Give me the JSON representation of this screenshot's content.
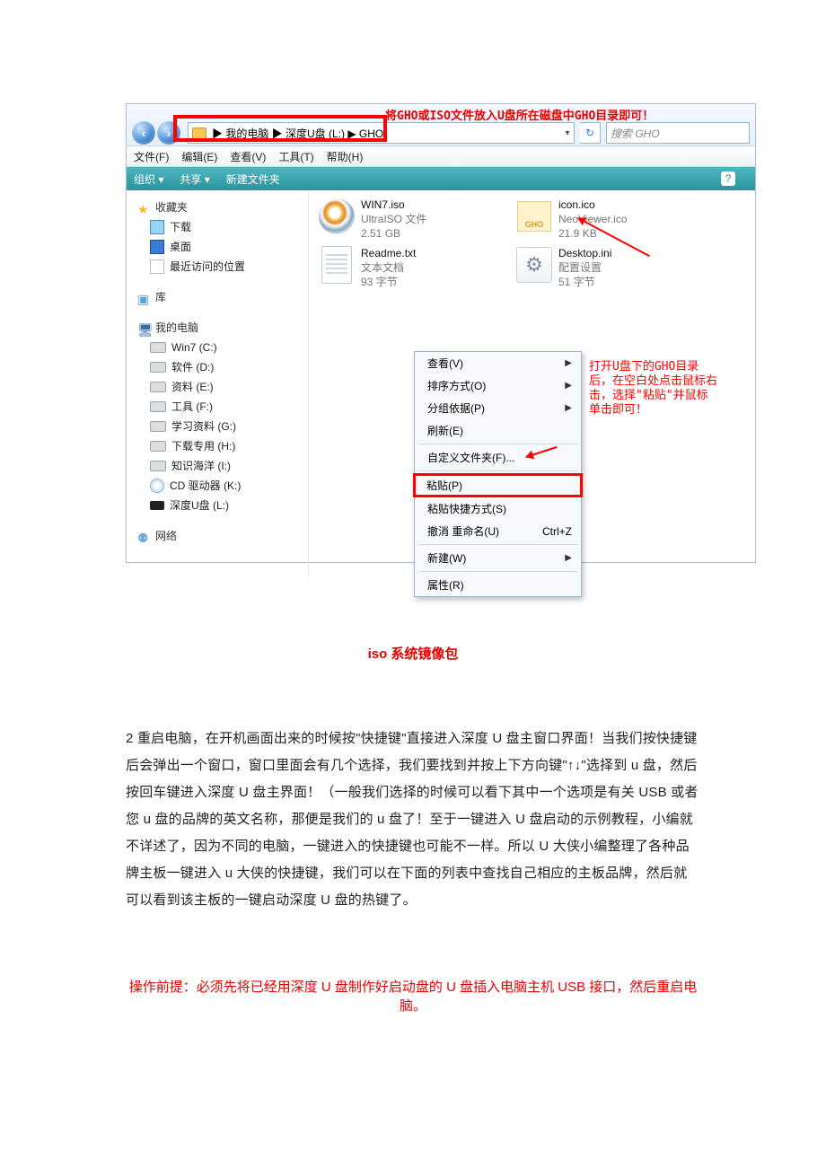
{
  "overlay": {
    "top_note": "将GHO或ISO文件放入U盘所在磁盘中GHO目录即可！"
  },
  "window": {
    "breadcrumb": "▶ 我的电脑 ▶ 深度U盘 (L:) ▶ GHO",
    "search_placeholder": "搜索 GHO",
    "menu": {
      "file": "文件(F)",
      "edit": "编辑(E)",
      "view": "查看(V)",
      "tools": "工具(T)",
      "help": "帮助(H)"
    },
    "cmd": {
      "organize": "组织 ▾",
      "share": "共享 ▾",
      "newfolder": "新建文件夹"
    }
  },
  "nav": {
    "fav": "收藏夹",
    "dl": "下载",
    "desk": "桌面",
    "recent": "最近访问的位置",
    "lib": "库",
    "pc": "我的电脑",
    "drives": [
      "Win7 (C:)",
      "软件 (D:)",
      "资料 (E:)",
      "工具 (F:)",
      "学习资料 (G:)",
      "下载专用 (H:)",
      "知识海洋 (I:)",
      "CD 驱动器 (K:)",
      "深度U盘 (L:)"
    ],
    "net": "网络"
  },
  "files": {
    "iso": {
      "name": "WIN7.iso",
      "sub1": "UltraISO 文件",
      "sub2": "2.51 GB"
    },
    "icon": {
      "name": "icon.ico",
      "sub1": "NeoViewer.ico",
      "sub2": "21.9 KB"
    },
    "readme": {
      "name": "Readme.txt",
      "sub1": "文本文档",
      "sub2": "93 字节"
    },
    "ini": {
      "name": "Desktop.ini",
      "sub1": "配置设置",
      "sub2": "51 字节"
    }
  },
  "ctx": {
    "view": "查看(V)",
    "sort": "排序方式(O)",
    "group": "分组依据(P)",
    "refresh": "刷新(E)",
    "custom": "自定义文件夹(F)...",
    "paste": "粘贴(P)",
    "pshort": "粘贴快捷方式(S)",
    "undo": "撤消 重命名(U)",
    "undo_key": "Ctrl+Z",
    "new": "新建(W)",
    "prop": "属性(R)"
  },
  "note1": {
    "l1": "打开U盘下的GHO目录",
    "l2": "后，在空白处点击鼠标右",
    "l3": "击，选择\"粘贴\"并鼠标",
    "l4": "单击即可！"
  },
  "caption": "iso 系统镜像包",
  "para": "2 重启电脑，在开机画面出来的时候按\"快捷键\"直接进入深度 U 盘主窗口界面！当我们按快捷键后会弹出一个窗口，窗口里面会有几个选择，我们要找到并按上下方向键\"↑↓\"选择到 u 盘，然后按回车键进入深度 U 盘主界面！（一般我们选择的时候可以看下其中一个选项是有关 USB 或者您 u 盘的品牌的英文名称，那便是我们的 u 盘了！至于一键进入 U 盘启动的示例教程，小编就不详述了，因为不同的电脑，一键进入的快捷键也可能不一样。所以 U 大侠小编整理了各种品牌主板一键进入 u 大侠的快捷键，我们可以在下面的列表中查找自己相应的主板品牌，然后就可以看到该主板的一键启动深度 U 盘的热键了。",
  "tip": "操作前提：必须先将已经用深度 U 盘制作好启动盘的 U 盘插入电脑主机 USB 接口，然后重启电脑。"
}
